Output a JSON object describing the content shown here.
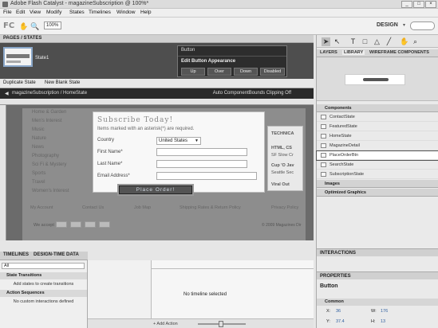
{
  "window": {
    "title": "Adobe Flash Catalyst - magazineSubscription @ 100%*",
    "controls": [
      "_",
      "□",
      "×"
    ]
  },
  "menu": [
    "File",
    "Edit",
    "View",
    "Modify",
    "States",
    "Timelines",
    "Window",
    "Help"
  ],
  "toolbar": {
    "logo": "FC",
    "hand_icon": "✋",
    "zoom_icon": "🔍",
    "zoom": "100%",
    "workspace": "DESIGN",
    "workspace_arrow": "▾"
  },
  "pages_states": {
    "header": "PAGES / STATES",
    "state_name": "State1",
    "duplicate_state": "Duplicate State",
    "new_blank_state": "New Blank State",
    "popup": {
      "title": "Button",
      "subtitle": "Edit Button Appearance",
      "states": [
        "Up",
        "Over",
        "Down",
        "Disabled"
      ]
    }
  },
  "breadcrumb": {
    "path": "magazineSubscription  /  HomeState",
    "right": "Auto ComponentBounds  Clipping Off"
  },
  "artboard": {
    "left_menu": [
      "Home & Garden",
      "Men's Interest",
      "Music",
      "Nature",
      "News",
      "Photography",
      "Sci Fi & Mystery",
      "Sports",
      "Travel",
      "Women's Interest"
    ],
    "form": {
      "title": "Subscribe Today!",
      "note": "Items marked with an asterisk(*) are required.",
      "country_label": "Country",
      "country_value": "United States",
      "first_name_label": "First Name*",
      "last_name_label": "Last Name*",
      "email_label": "Email Address*",
      "button_label": "Place Order!"
    },
    "right_card": [
      "TECHNICA",
      "HTML, CS",
      "SF Slow Cr",
      "Cup 'O Jav",
      "Seattle Sec",
      "Viral Out"
    ],
    "footer_links": [
      "My Account",
      "Contact Us",
      "Job Map",
      "Shipping Rates & Return Policy",
      "Privacy Policy"
    ],
    "accept": "We accept",
    "copyright": "© 2009 Magazines Dir"
  },
  "timeline": {
    "tabs": [
      "TIMELINES",
      "DESIGN-TIME DATA"
    ],
    "filter": "All",
    "state_transitions": "State Transitions",
    "add_states_hint": "Add states to create transitions",
    "action_sequences": "Action Sequences",
    "no_interactions": "No custom interactions defined",
    "no_timeline": "No timeline selected",
    "add_action": "+ Add Action"
  },
  "right_panel": {
    "tabs": [
      "LAYERS",
      "LIBRARY",
      "WIREFRAME COMPONENTS"
    ],
    "components_header": "Components",
    "components": [
      "ContactState",
      "FeaturedState",
      "HomeState",
      "MagazineDetail",
      "PlaceOrderBtn",
      "SearchState",
      "SubscriptionState"
    ],
    "images_header": "Images",
    "optimized_header": "Optimized Graphics",
    "interactions_header": "INTERACTIONS",
    "properties_header": "PROPERTIES",
    "props_title": "Button",
    "common_header": "Common",
    "x_label": "X:",
    "x_value": "36",
    "y_label": "Y:",
    "y_value": "37.4",
    "w_label": "W:",
    "w_value": "176",
    "h_label": "H:",
    "h_value": "13"
  }
}
